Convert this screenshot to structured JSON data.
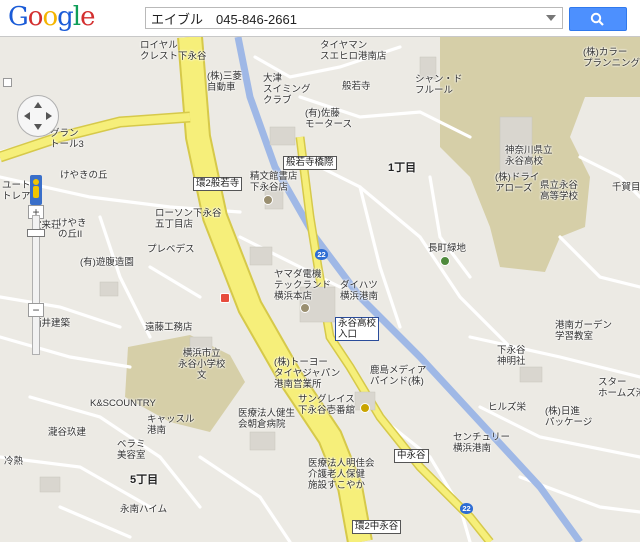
{
  "app": {
    "logo_text": "Google",
    "logo_colors": [
      "#1a5bd7",
      "#d32f2f",
      "#f4b400",
      "#1a5bd7",
      "#0f9d58",
      "#d32f2f"
    ]
  },
  "search": {
    "value": "エイブル　045-846-2661"
  },
  "colors": {
    "highway": "#f6ef7a",
    "highway_edge": "#d6c94a",
    "river": "#9fb8e6",
    "land": "#eceae4",
    "school": "#d6cfa8",
    "road": "#ffffff"
  },
  "controls": {
    "zoom_in": "+",
    "zoom_out": "−"
  },
  "labels": [
    {
      "id": "royal",
      "text": "ロイヤル\nクレスト下永谷"
    },
    {
      "id": "tyaiyaman",
      "text": "タイヤマン\nスエヒロ港南店"
    },
    {
      "id": "sanryo",
      "text": "(株)三菱\n自動車"
    },
    {
      "id": "otsu",
      "text": "大津\nスイミング\nクラブ"
    },
    {
      "id": "hannyaji",
      "text": "般若寺"
    },
    {
      "id": "sato",
      "text": "(有)佐藤\nモータース"
    },
    {
      "id": "chandfleur",
      "text": "シャン・ド\nフルール"
    },
    {
      "id": "karaplanning",
      "text": "(株)カラー\nプランニング"
    },
    {
      "id": "grandtoor",
      "text": "グラン\nトール3"
    },
    {
      "id": "seibun",
      "text": "精文館書店\n下永谷店"
    },
    {
      "id": "hannyaji_kousaten",
      "text": "般若寺橋際"
    },
    {
      "id": "chome1",
      "text": "1丁目"
    },
    {
      "id": "kanagawa_school",
      "text": "神奈川県立\n永谷高校"
    },
    {
      "id": "kariyaku",
      "text": "けやきの丘"
    },
    {
      "id": "dryarrows",
      "text": "(株)ドライ\nアローズ"
    },
    {
      "id": "kenritsu",
      "text": "県立永谷\n高等学校"
    },
    {
      "id": "senga",
      "text": "千賀目"
    },
    {
      "id": "yuto",
      "text": "ユート\nトレア"
    },
    {
      "id": "treasure",
      "text": "宝来荘"
    },
    {
      "id": "keyakioka2",
      "text": "けやき\nの丘II"
    },
    {
      "id": "lawson",
      "text": "ローソン下永谷\n五丁目店"
    },
    {
      "id": "prevedes",
      "text": "プレベデス"
    },
    {
      "id": "nagaya",
      "text": "長町緑地"
    },
    {
      "id": "yuraku",
      "text": "(有)遊腹造園"
    },
    {
      "id": "yamada",
      "text": "ヤマダ電機\nテックランド\n横浜本店"
    },
    {
      "id": "daihatsu",
      "text": "ダイハツ\n横浜港南"
    },
    {
      "id": "sakai",
      "text": "酒井建築"
    },
    {
      "id": "endo",
      "text": "遠藤工務店"
    },
    {
      "id": "nagaya_koko",
      "text": "永谷高校\n入口"
    },
    {
      "id": "konan_garden",
      "text": "港南ガーデン\n学習教室"
    },
    {
      "id": "yokohama_elem",
      "text": "横浜市立\n永谷小学校\n文"
    },
    {
      "id": "toyota",
      "text": "(株)トーヨー\nタイヤジャパン\n港南営業所"
    },
    {
      "id": "shimonagaya_shrine",
      "text": "下永谷\n神明社"
    },
    {
      "id": "kashima",
      "text": "鹿島メディア\nパインド(株)"
    },
    {
      "id": "ks",
      "text": "K&SCOUNTRY"
    },
    {
      "id": "castle",
      "text": "キャッスル\n港南"
    },
    {
      "id": "hiruzu",
      "text": "ヒルズ栄"
    },
    {
      "id": "nissei",
      "text": "(株)日進\nパッケージ"
    },
    {
      "id": "star",
      "text": "スター\nホームズ港"
    },
    {
      "id": "iryo",
      "text": "医療法人健生\n会朝倉病院"
    },
    {
      "id": "sungrace",
      "text": "サングレイス\n下永谷壱番舘"
    },
    {
      "id": "takitani",
      "text": "瀧谷玖建"
    },
    {
      "id": "berumi",
      "text": "ベラミ\n美容室"
    },
    {
      "id": "century",
      "text": "センチュリー\n横浜港南"
    },
    {
      "id": "reisei",
      "text": "冷熱"
    },
    {
      "id": "iryo2",
      "text": "医療法人明佳会\n介護老人保健\n施設すこやか"
    },
    {
      "id": "chome5",
      "text": "5丁目"
    },
    {
      "id": "nagahaim",
      "text": "永南ハイム"
    }
  ],
  "shields": [
    {
      "id": "kan2_hannyaji",
      "text": "環2般若寺"
    },
    {
      "id": "hannyaji_bridge",
      "text": "般若寺橋際"
    },
    {
      "id": "nagaya_entrance",
      "text": "永谷高校\n入口"
    },
    {
      "id": "nakanagaya",
      "text": "中永谷"
    },
    {
      "id": "kan2_nakanagaya",
      "text": "環2中永谷"
    }
  ],
  "routes": [
    {
      "text": "22"
    },
    {
      "text": "22"
    }
  ]
}
